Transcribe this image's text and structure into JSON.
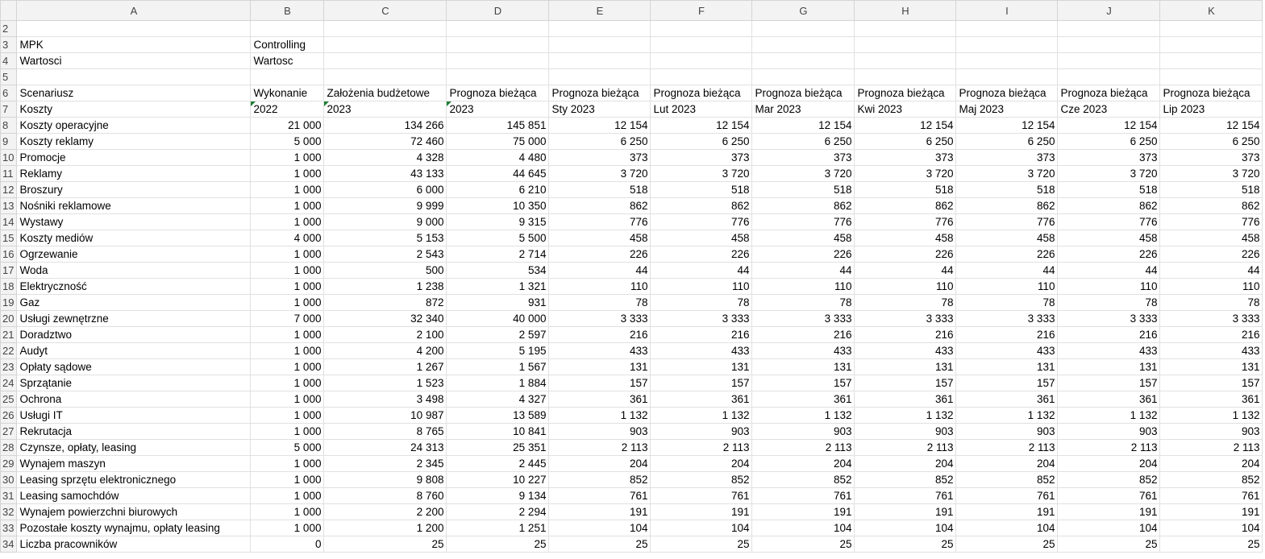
{
  "columns": [
    "A",
    "B",
    "C",
    "D",
    "E",
    "F",
    "G",
    "H",
    "I",
    "J",
    "K"
  ],
  "rows": [
    {
      "n": "2",
      "cells": [
        "",
        "",
        "",
        "",
        "",
        "",
        "",
        "",
        "",
        "",
        ""
      ]
    },
    {
      "n": "3",
      "cells": [
        "MPK",
        "Controlling",
        "",
        "",
        "",
        "",
        "",
        "",
        "",
        "",
        ""
      ]
    },
    {
      "n": "4",
      "cells": [
        "Wartosci",
        "Wartosc",
        "",
        "",
        "",
        "",
        "",
        "",
        "",
        "",
        ""
      ]
    },
    {
      "n": "5",
      "cells": [
        "",
        "",
        "",
        "",
        "",
        "",
        "",
        "",
        "",
        "",
        ""
      ]
    },
    {
      "n": "6",
      "cells": [
        "Scenariusz",
        "Wykonanie",
        "Założenia budżetowe",
        "Prognoza bieżąca",
        "Prognoza bieżąca",
        "Prognoza bieżąca",
        "Prognoza bieżąca",
        "Prognoza bieżąca",
        "Prognoza bieżąca",
        "Prognoza bieżąca",
        "Prognoza bieżąca"
      ]
    },
    {
      "n": "7",
      "cells": [
        "Koszty",
        "2022",
        "2023",
        "2023",
        "Sty 2023",
        "Lut 2023",
        "Mar 2023",
        "Kwi 2023",
        "Maj 2023",
        "Cze 2023",
        "Lip 2023"
      ]
    },
    {
      "n": "8",
      "cells": [
        "Koszty operacyjne",
        "21 000",
        "134 266",
        "145 851",
        "12 154",
        "12 154",
        "12 154",
        "12 154",
        "12 154",
        "12 154",
        "12 154"
      ]
    },
    {
      "n": "9",
      "cells": [
        "Koszty reklamy",
        "5 000",
        "72 460",
        "75 000",
        "6 250",
        "6 250",
        "6 250",
        "6 250",
        "6 250",
        "6 250",
        "6 250"
      ]
    },
    {
      "n": "10",
      "cells": [
        "Promocje",
        "1 000",
        "4 328",
        "4 480",
        "373",
        "373",
        "373",
        "373",
        "373",
        "373",
        "373"
      ]
    },
    {
      "n": "11",
      "cells": [
        "Reklamy",
        "1 000",
        "43 133",
        "44 645",
        "3 720",
        "3 720",
        "3 720",
        "3 720",
        "3 720",
        "3 720",
        "3 720"
      ]
    },
    {
      "n": "12",
      "cells": [
        "Broszury",
        "1 000",
        "6 000",
        "6 210",
        "518",
        "518",
        "518",
        "518",
        "518",
        "518",
        "518"
      ]
    },
    {
      "n": "13",
      "cells": [
        "Nośniki reklamowe",
        "1 000",
        "9 999",
        "10 350",
        "862",
        "862",
        "862",
        "862",
        "862",
        "862",
        "862"
      ]
    },
    {
      "n": "14",
      "cells": [
        "Wystawy",
        "1 000",
        "9 000",
        "9 315",
        "776",
        "776",
        "776",
        "776",
        "776",
        "776",
        "776"
      ]
    },
    {
      "n": "15",
      "cells": [
        "Koszty mediów",
        "4 000",
        "5 153",
        "5 500",
        "458",
        "458",
        "458",
        "458",
        "458",
        "458",
        "458"
      ]
    },
    {
      "n": "16",
      "cells": [
        "Ogrzewanie",
        "1 000",
        "2 543",
        "2 714",
        "226",
        "226",
        "226",
        "226",
        "226",
        "226",
        "226"
      ]
    },
    {
      "n": "17",
      "cells": [
        "Woda",
        "1 000",
        "500",
        "534",
        "44",
        "44",
        "44",
        "44",
        "44",
        "44",
        "44"
      ]
    },
    {
      "n": "18",
      "cells": [
        "Elektryczność",
        "1 000",
        "1 238",
        "1 321",
        "110",
        "110",
        "110",
        "110",
        "110",
        "110",
        "110"
      ]
    },
    {
      "n": "19",
      "cells": [
        "Gaz",
        "1 000",
        "872",
        "931",
        "78",
        "78",
        "78",
        "78",
        "78",
        "78",
        "78"
      ]
    },
    {
      "n": "20",
      "cells": [
        "Usługi zewnętrzne",
        "7 000",
        "32 340",
        "40 000",
        "3 333",
        "3 333",
        "3 333",
        "3 333",
        "3 333",
        "3 333",
        "3 333"
      ]
    },
    {
      "n": "21",
      "cells": [
        "Doradztwo",
        "1 000",
        "2 100",
        "2 597",
        "216",
        "216",
        "216",
        "216",
        "216",
        "216",
        "216"
      ]
    },
    {
      "n": "22",
      "cells": [
        "Audyt",
        "1 000",
        "4 200",
        "5 195",
        "433",
        "433",
        "433",
        "433",
        "433",
        "433",
        "433"
      ]
    },
    {
      "n": "23",
      "cells": [
        "Opłaty sądowe",
        "1 000",
        "1 267",
        "1 567",
        "131",
        "131",
        "131",
        "131",
        "131",
        "131",
        "131"
      ]
    },
    {
      "n": "24",
      "cells": [
        "Sprzątanie",
        "1 000",
        "1 523",
        "1 884",
        "157",
        "157",
        "157",
        "157",
        "157",
        "157",
        "157"
      ]
    },
    {
      "n": "25",
      "cells": [
        "Ochrona",
        "1 000",
        "3 498",
        "4 327",
        "361",
        "361",
        "361",
        "361",
        "361",
        "361",
        "361"
      ]
    },
    {
      "n": "26",
      "cells": [
        "Usługi IT",
        "1 000",
        "10 987",
        "13 589",
        "1 132",
        "1 132",
        "1 132",
        "1 132",
        "1 132",
        "1 132",
        "1 132"
      ]
    },
    {
      "n": "27",
      "cells": [
        "Rekrutacja",
        "1 000",
        "8 765",
        "10 841",
        "903",
        "903",
        "903",
        "903",
        "903",
        "903",
        "903"
      ]
    },
    {
      "n": "28",
      "cells": [
        "Czynsze, opłaty, leasing",
        "5 000",
        "24 313",
        "25 351",
        "2 113",
        "2 113",
        "2 113",
        "2 113",
        "2 113",
        "2 113",
        "2 113"
      ]
    },
    {
      "n": "29",
      "cells": [
        "Wynajem maszyn",
        "1 000",
        "2 345",
        "2 445",
        "204",
        "204",
        "204",
        "204",
        "204",
        "204",
        "204"
      ]
    },
    {
      "n": "30",
      "cells": [
        "Leasing sprzętu elektronicznego",
        "1 000",
        "9 808",
        "10 227",
        "852",
        "852",
        "852",
        "852",
        "852",
        "852",
        "852"
      ]
    },
    {
      "n": "31",
      "cells": [
        "Leasing samochdów",
        "1 000",
        "8 760",
        "9 134",
        "761",
        "761",
        "761",
        "761",
        "761",
        "761",
        "761"
      ]
    },
    {
      "n": "32",
      "cells": [
        "Wynajem powierzchni biurowych",
        "1 000",
        "2 200",
        "2 294",
        "191",
        "191",
        "191",
        "191",
        "191",
        "191",
        "191"
      ]
    },
    {
      "n": "33",
      "cells": [
        "Pozostałe koszty wynajmu, opłaty leasing",
        "1 000",
        "1 200",
        "1 251",
        "104",
        "104",
        "104",
        "104",
        "104",
        "104",
        "104"
      ]
    },
    {
      "n": "34",
      "cells": [
        "Liczba pracowników",
        "0",
        "25",
        "25",
        "25",
        "25",
        "25",
        "25",
        "25",
        "25",
        "25"
      ]
    }
  ]
}
